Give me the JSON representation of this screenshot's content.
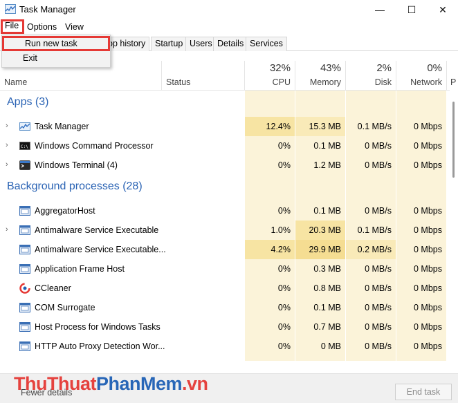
{
  "window": {
    "title": "Task Manager",
    "min_glyph": "—",
    "max_glyph": "☐",
    "close_glyph": "✕"
  },
  "menu": {
    "file": "File",
    "options": "Options",
    "view": "View"
  },
  "file_menu": {
    "run_new_task": "Run new task",
    "exit": "Exit"
  },
  "tabs": [
    "op history",
    "Startup",
    "Users",
    "Details",
    "Services"
  ],
  "columns": {
    "name": "Name",
    "status": "Status",
    "cpu": {
      "pct": "32%",
      "label": "CPU"
    },
    "memory": {
      "pct": "43%",
      "label": "Memory"
    },
    "disk": {
      "pct": "2%",
      "label": "Disk"
    },
    "network": {
      "pct": "0%",
      "label": "Network"
    },
    "power_partial": "P"
  },
  "groups": {
    "apps": "Apps (3)",
    "background": "Background processes (28)"
  },
  "apps": [
    {
      "name": "Task Manager",
      "cpu": "12.4%",
      "memory": "15.3 MB",
      "disk": "0.1 MB/s",
      "network": "0 Mbps",
      "icon": "task-manager-icon"
    },
    {
      "name": "Windows Command Processor",
      "cpu": "0%",
      "memory": "0.1 MB",
      "disk": "0 MB/s",
      "network": "0 Mbps",
      "icon": "cmd-icon"
    },
    {
      "name": "Windows Terminal (4)",
      "cpu": "0%",
      "memory": "1.2 MB",
      "disk": "0 MB/s",
      "network": "0 Mbps",
      "icon": "terminal-icon"
    }
  ],
  "background": [
    {
      "name": "AggregatorHost",
      "cpu": "0%",
      "memory": "0.1 MB",
      "disk": "0 MB/s",
      "network": "0 Mbps"
    },
    {
      "name": "Antimalware Service Executable",
      "cpu": "1.0%",
      "memory": "20.3 MB",
      "disk": "0.1 MB/s",
      "network": "0 Mbps"
    },
    {
      "name": "Antimalware Service Executable...",
      "cpu": "4.2%",
      "memory": "29.9 MB",
      "disk": "0.2 MB/s",
      "network": "0 Mbps"
    },
    {
      "name": "Application Frame Host",
      "cpu": "0%",
      "memory": "0.3 MB",
      "disk": "0 MB/s",
      "network": "0 Mbps"
    },
    {
      "name": "CCleaner",
      "cpu": "0%",
      "memory": "0.8 MB",
      "disk": "0 MB/s",
      "network": "0 Mbps"
    },
    {
      "name": "COM Surrogate",
      "cpu": "0%",
      "memory": "0.1 MB",
      "disk": "0 MB/s",
      "network": "0 Mbps"
    },
    {
      "name": "Host Process for Windows Tasks",
      "cpu": "0%",
      "memory": "0.7 MB",
      "disk": "0 MB/s",
      "network": "0 Mbps"
    },
    {
      "name": "HTTP Auto Proxy Detection Wor...",
      "cpu": "0%",
      "memory": "0 MB",
      "disk": "0 MB/s",
      "network": "0 Mbps"
    }
  ],
  "footer": {
    "fewer_details": "Fewer details",
    "end_task": "End task"
  },
  "watermark": {
    "part1": "Thu",
    "part2": "Thuat",
    "part3": "PhanMem",
    "part4": ".vn"
  },
  "colors": {
    "accent_blue": "#2a63b4",
    "highlight_red": "#e53935",
    "usage_yellow": "#fbf3d9",
    "usage_hot": "#f7e4a3"
  }
}
